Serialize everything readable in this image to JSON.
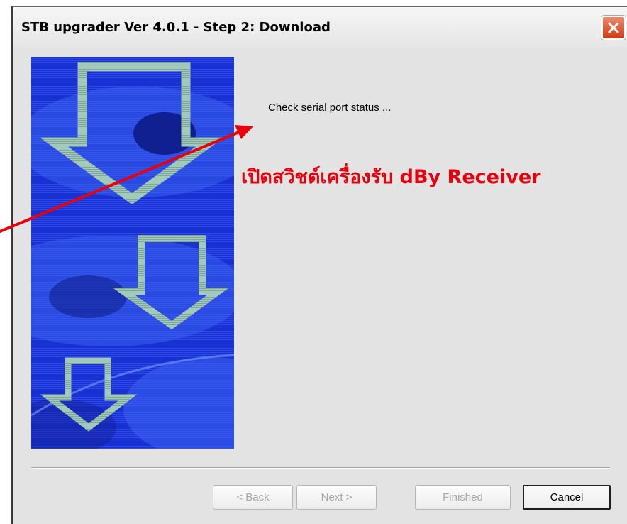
{
  "window": {
    "title": "STB upgrader Ver 4.0.1 - Step 2: Download",
    "close_icon": "close-icon"
  },
  "banner": {
    "icon": "download-arrows-image"
  },
  "content": {
    "status_text": "Check serial port status ..."
  },
  "annotation": {
    "text": "เปิดสวิชต์เครื่องรับ dBy Receiver",
    "arrow_icon": "red-arrow-icon"
  },
  "buttons": {
    "back": {
      "label": "< Back",
      "enabled": false
    },
    "next": {
      "label": "Next >",
      "enabled": false
    },
    "finished": {
      "label": "Finished",
      "enabled": false
    },
    "cancel": {
      "label": "Cancel",
      "enabled": true
    }
  },
  "colors": {
    "window_face": "#e3e3e3",
    "close_button": "#cf3b18",
    "annotation_red": "#e8000d",
    "disabled_text": "#a6a6a6",
    "banner_blue": "#1b30d2",
    "banner_arrow": "#a3c9b8"
  }
}
